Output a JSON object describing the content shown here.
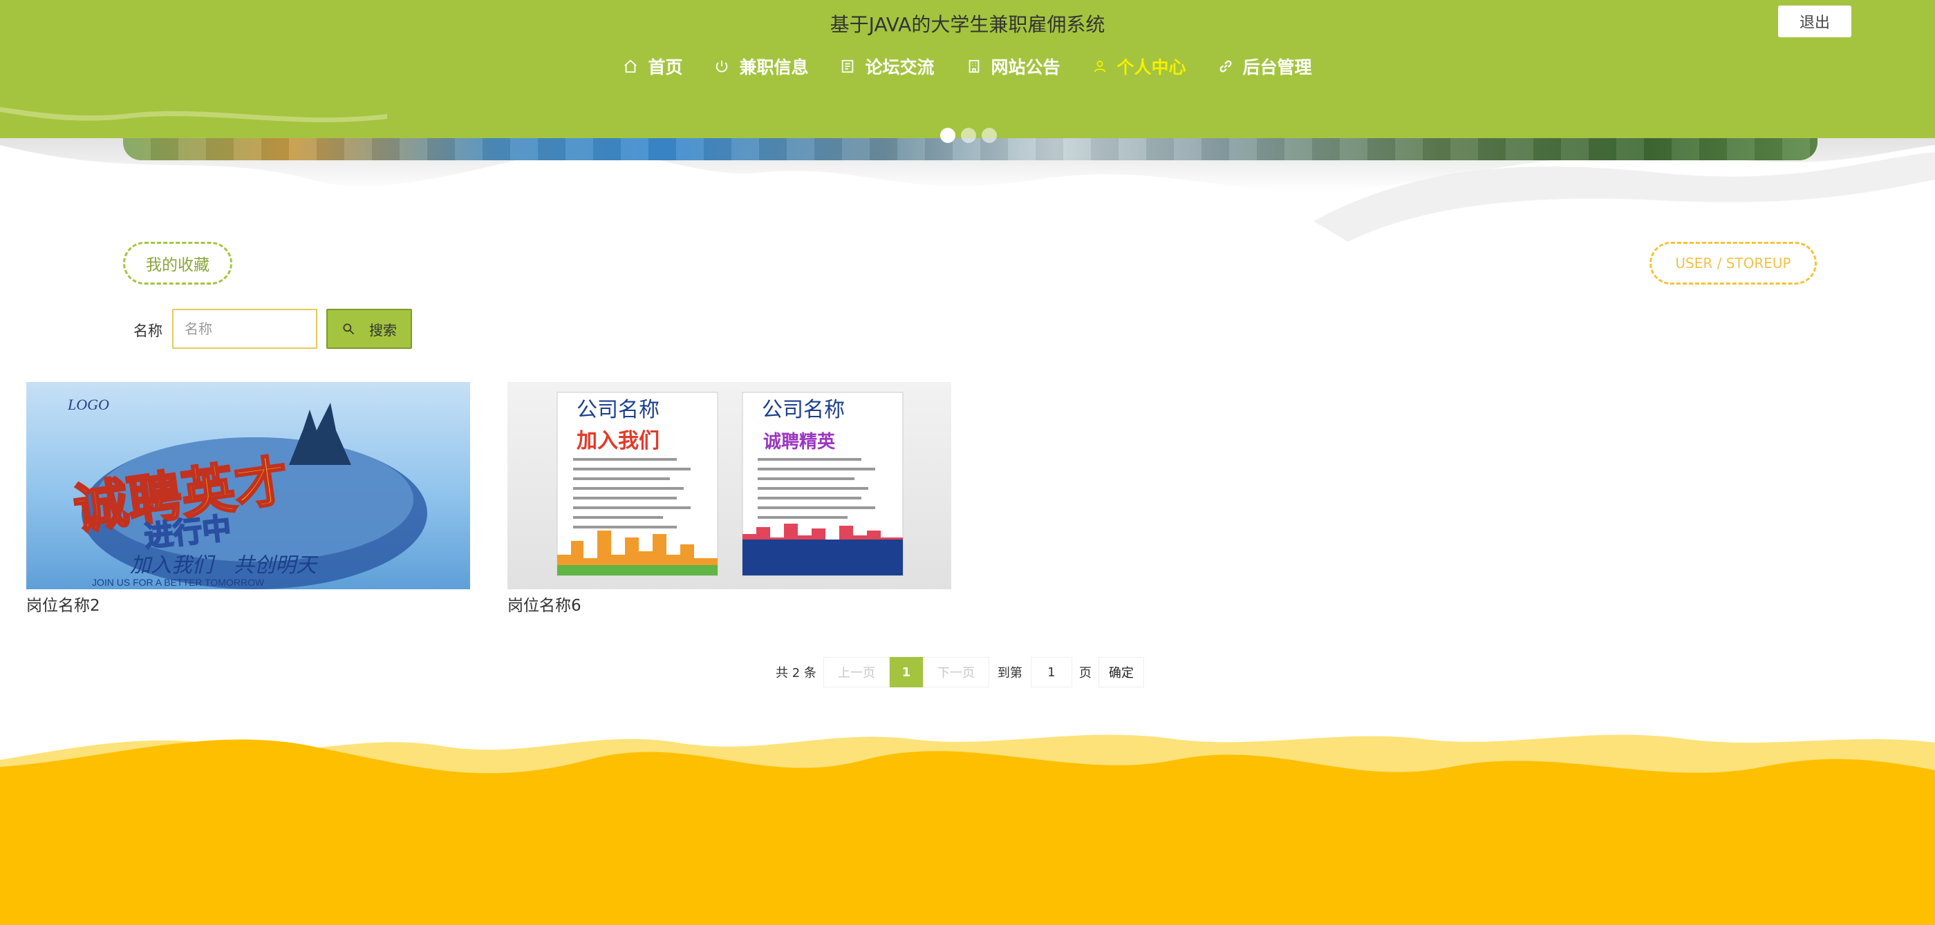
{
  "header": {
    "title": "基于JAVA的大学生兼职雇佣系统",
    "logout_label": "退出",
    "nav": [
      {
        "label": "首页",
        "icon": "home-icon"
      },
      {
        "label": "兼职信息",
        "icon": "power-icon"
      },
      {
        "label": "论坛交流",
        "icon": "document-icon"
      },
      {
        "label": "网站公告",
        "icon": "building-icon"
      },
      {
        "label": "个人中心",
        "icon": "user-icon",
        "active": true
      },
      {
        "label": "后台管理",
        "icon": "link-icon"
      }
    ]
  },
  "carousel": {
    "slide_count": 3,
    "active_index": 0
  },
  "section": {
    "title": "我的收藏",
    "subtitle": "USER / STOREUP"
  },
  "search": {
    "label": "名称",
    "placeholder": "名称",
    "value": "",
    "button_label": "搜索"
  },
  "items": [
    {
      "title": "岗位名称2",
      "image_text_main": "诚聘英才",
      "image_text_sub": "进行中",
      "image_text_bottom": "加入我们　共创明天",
      "image_text_en": "JOIN US FOR A BETTER TOMORROW",
      "image_logo": "LOGO"
    },
    {
      "title": "岗位名称6",
      "image_poster_heading": "公司名称",
      "image_poster_left": "加入我们",
      "image_poster_right": "诚聘精英"
    }
  ],
  "pagination": {
    "total_label": "共 2 条",
    "prev_label": "上一页",
    "current_page": "1",
    "next_label": "下一页",
    "goto_label": "到第",
    "goto_value": "1",
    "page_label": "页",
    "confirm_label": "确定"
  },
  "colors": {
    "header_green": "#a4c43f",
    "active_nav": "#f4f000",
    "footer_yellow": "#fdbf00",
    "accent_dashed_yellow": "#f5c330"
  }
}
